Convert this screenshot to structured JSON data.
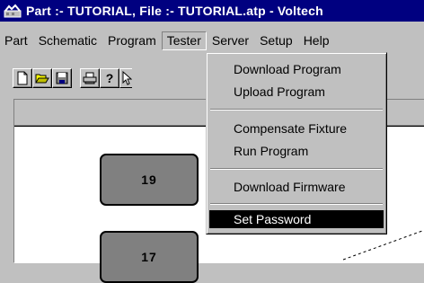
{
  "window": {
    "title": "Part :- TUTORIAL, File :- TUTORIAL.atp - Voltech"
  },
  "menubar": {
    "items": [
      "Part",
      "Schematic",
      "Program",
      "Tester",
      "Server",
      "Setup",
      "Help"
    ],
    "open_index": 3
  },
  "toolbar": {
    "icons": [
      "new-file-icon",
      "open-folder-icon",
      "save-disk-icon",
      "print-icon",
      "help-icon",
      "context-help-icon"
    ]
  },
  "tester_menu": {
    "items": [
      {
        "label": "Download Program"
      },
      {
        "label": "Upload Program"
      },
      {
        "label": "Compensate Fixture"
      },
      {
        "label": "Run Program"
      },
      {
        "label": "Download Firmware"
      },
      {
        "label": "Set Password",
        "selected": true
      }
    ]
  },
  "workspace": {
    "pins": [
      {
        "label": "19"
      },
      {
        "label": "17"
      }
    ]
  },
  "colors": {
    "titlebar": "#000080",
    "face": "#c0c0c0",
    "pin_fill": "#808080",
    "highlight": "#000000"
  }
}
